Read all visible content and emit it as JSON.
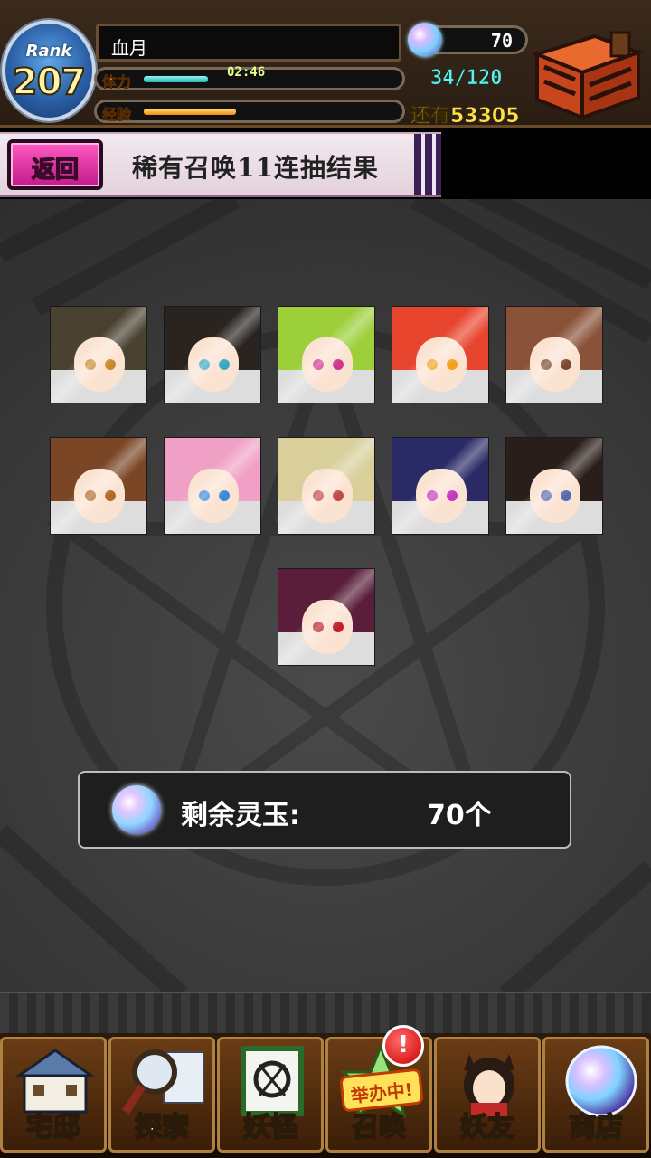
{
  "header": {
    "rank_label": "Rank",
    "rank_value": "207",
    "player_name": "血月",
    "stamina_label": "体力",
    "stamina_timer": "02:46",
    "stamina_fill_fraction": 0.25,
    "exp_label": "经验",
    "exp_fill_fraction": 0.36,
    "gems": "70",
    "stamina_text": "34/120",
    "exp_remaining_text": "还有53305"
  },
  "titlebar": {
    "back_label": "返回",
    "title": "稀有召唤11连抽结果"
  },
  "results": {
    "cards": [
      {
        "hair": "#4a4230",
        "eyes": "#c98a2a"
      },
      {
        "hair": "#2a2420",
        "eyes": "#3aa8c0"
      },
      {
        "hair": "#9ccf3a",
        "eyes": "#d2348f"
      },
      {
        "hair": "#e8452e",
        "eyes": "#f0a21a"
      },
      {
        "hair": "#8a5238",
        "eyes": "#7a4a30"
      },
      {
        "hair": "#7a4626",
        "eyes": "#b06a2a"
      },
      {
        "hair": "#f0a0c4",
        "eyes": "#3a8ad8"
      },
      {
        "hair": "#d8cf9a",
        "eyes": "#c04a4a"
      },
      {
        "hair": "#2a2a66",
        "eyes": "#c03ac0"
      },
      {
        "hair": "#2a1e1a",
        "eyes": "#5a6ab0"
      },
      {
        "hair": "#5a1e3a",
        "eyes": "#c0202a"
      }
    ]
  },
  "balance": {
    "label": "剩余灵玉:",
    "value": "70个"
  },
  "nav": {
    "items": [
      {
        "label": "宅邸",
        "icon": "mansion-icon"
      },
      {
        "label": "探索",
        "icon": "magnifier-map-icon"
      },
      {
        "label": "妖怪",
        "icon": "scroll-icon"
      },
      {
        "label": "召唤",
        "icon": "summon-star-icon",
        "badge": "举办中!",
        "alert": "!"
      },
      {
        "label": "妖友",
        "icon": "friend-catgirl-icon"
      },
      {
        "label": "商店",
        "icon": "orb-shop-icon"
      }
    ]
  },
  "colors": {
    "accent_pink": "#d82a9a",
    "stamina_teal": "#5ff0e6",
    "exp_gold": "#ffe14a"
  }
}
